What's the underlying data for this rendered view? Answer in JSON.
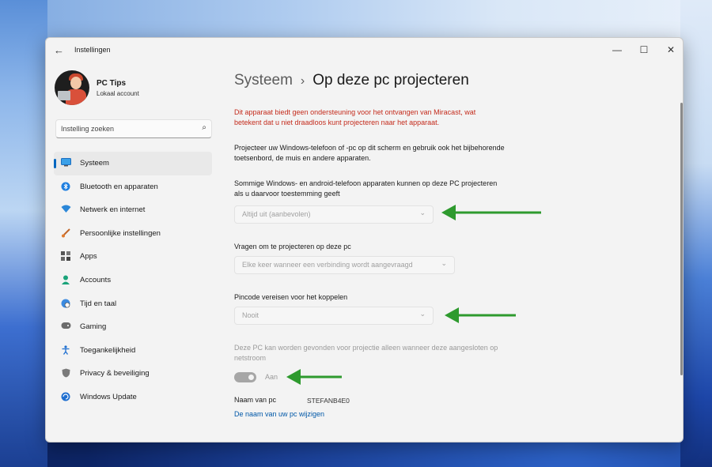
{
  "window": {
    "title": "Instellingen",
    "back_icon": "back-arrow-icon",
    "controls": {
      "minimize": "—",
      "maximize": "☐",
      "close": "✕"
    }
  },
  "profile": {
    "name": "PC Tips",
    "account": "Lokaal account"
  },
  "search": {
    "placeholder": "Instelling zoeken"
  },
  "sidebar": {
    "items": [
      {
        "label": "Systeem",
        "icon": "monitor-icon",
        "active": true
      },
      {
        "label": "Bluetooth en apparaten",
        "icon": "bluetooth-icon"
      },
      {
        "label": "Netwerk en internet",
        "icon": "wifi-icon"
      },
      {
        "label": "Persoonlijke instellingen",
        "icon": "brush-icon"
      },
      {
        "label": "Apps",
        "icon": "apps-icon"
      },
      {
        "label": "Accounts",
        "icon": "person-icon"
      },
      {
        "label": "Tijd en taal",
        "icon": "globe-clock-icon"
      },
      {
        "label": "Gaming",
        "icon": "gamepad-icon"
      },
      {
        "label": "Toegankelijkheid",
        "icon": "accessibility-icon"
      },
      {
        "label": "Privacy & beveiliging",
        "icon": "shield-icon"
      },
      {
        "label": "Windows Update",
        "icon": "update-icon"
      }
    ]
  },
  "breadcrumb": {
    "parent": "Systeem",
    "separator": "›",
    "current": "Op deze pc projecteren"
  },
  "content": {
    "warning": "Dit apparaat biedt geen ondersteuning voor het ontvangen van Miracast, wat betekent dat u niet draadloos kunt projecteren naar het apparaat.",
    "description": "Projecteer uw Windows-telefoon of -pc op dit scherm en gebruik ook het bijbehorende toetsenbord, de muis en andere apparaten.",
    "setting1": {
      "label": "Sommige Windows- en android-telefoon apparaten kunnen op deze PC projecteren als u daarvoor toestemming geeft",
      "value": "Altijd uit (aanbevolen)"
    },
    "setting2": {
      "label": "Vragen om te projecteren op deze pc",
      "value": "Elke keer wanneer een verbinding wordt aangevraagd"
    },
    "setting3": {
      "label": "Pincode vereisen voor het koppelen",
      "value": "Nooit"
    },
    "setting4": {
      "label": "Deze PC kan worden gevonden voor projectie alleen wanneer deze aangesloten op netstroom",
      "toggle_state": "Aan"
    },
    "pc_name_label": "Naam van pc",
    "pc_name_value": "STEFANB4E0",
    "rename_link": "De naam van uw pc wijzigen"
  },
  "colors": {
    "accent": "#0067c0",
    "warning": "#c42b1c",
    "annotation_arrow": "#2e9a2e"
  }
}
